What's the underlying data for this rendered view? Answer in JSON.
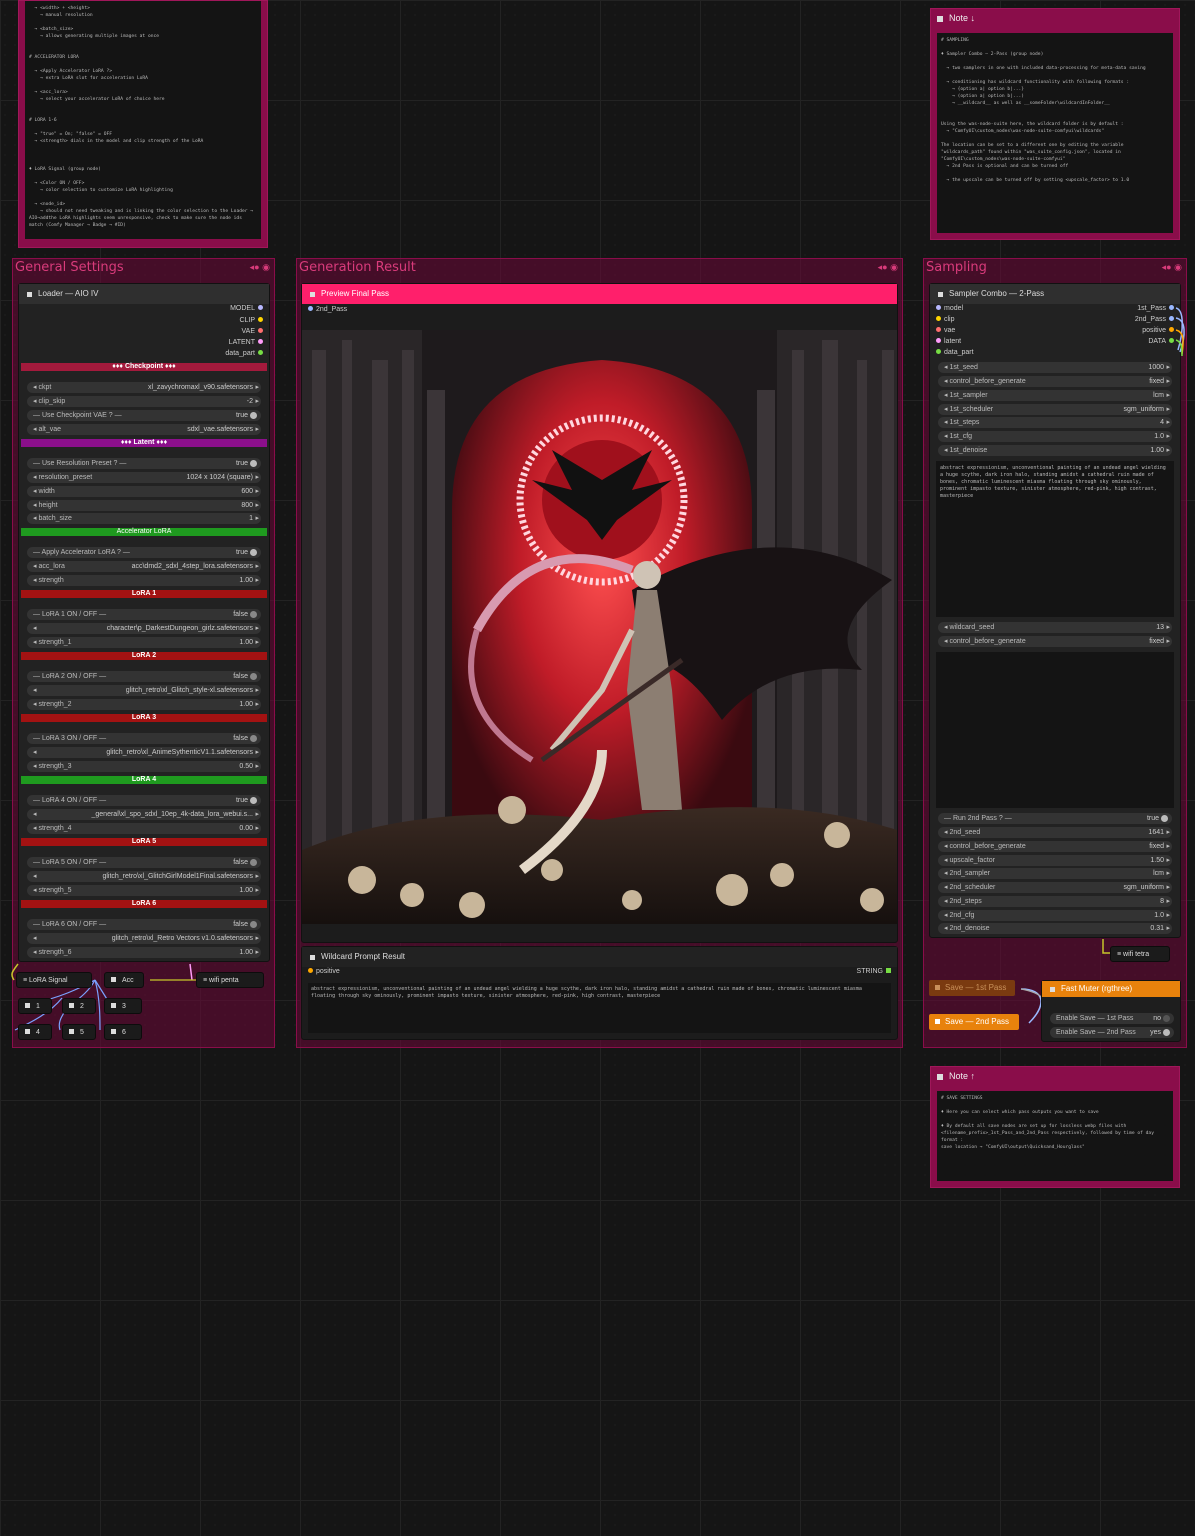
{
  "notes": {
    "top_left": {
      "text": "  → <width> + <height>\n    → manual resolution\n\n  → <batch_size>\n    → allows generating multiple images at once\n\n\n# ACCELERATOR LORA\n\n  → <Apply Accelerator LoRA ?>\n    → extra LoRA slot for acceleration LoRA\n\n  → <acc_lora>\n    → select your accelerator LoRA of choice here\n\n\n# LORA 1-6\n\n  → \"true\" = On; \"false\" = OFF\n  → <strength> dials in the model and clip strength of the LoRA\n\n\n\n♦ LoRA Signal (group node)\n\n  → <Color ON / OFF>\n    → color selection to customize LoRA highlighting\n\n  → <node_id>\n    → should not need tweaking and is linking the color selection to the Loader →\nAIO→addthe LoRA highlights seem unresponsive, check to make sure the node ids\nmatch (Comfy Manager → Badge → #ID)"
    },
    "top_right": {
      "title": "Note ↓",
      "text": "# SAMPLING\n\n♦ Sampler Combo — 2-Pass (group node)\n\n  → two samplers in one with included data-processing for meta-data saving\n\n  → conditioning has wildcard functionality with following formats :\n    → {option a| option b|...}\n    → (option a| option b|...)\n    → __wildcard__ as well as __someFolder\\wildcardInFolder__\n\n\nUsing the was-node-suite here, the wildcard folder is by default :\n  → \"ComfyUI\\custom_nodes\\was-node-suite-comfyui\\wildcards\"\n\nThe location can be set to a different one by editing the variable\n\"wildcards_path\" found within \"was_suite_config.json\", located in\n\"ComfyUI\\custom_nodes\\was-node-suite-comfyui\"\n  → 2nd Pass is optional and can be turned off\n\n  → the upscale can be turned off by setting <upscale_factor> to 1.0"
    },
    "bottom_right": {
      "title": "Note ↑",
      "text": "# SAVE SETTINGS\n\n♦ Here you can select which pass outputs you want to save\n\n♦ By default all save nodes are set up for lossless webp files with\n<filename_prefix>_1st_Pass_and_2nd_Pass respectively, followed by time of day\nformat :\nsave location → \"ComfyUI\\output\\Quicksand_Hourglass\""
    }
  },
  "groups": {
    "general": {
      "title": "General Settings"
    },
    "generation": {
      "title": "Generation Result"
    },
    "sampling": {
      "title": "Sampling"
    }
  },
  "loader": {
    "title": "Loader — AIO IV",
    "outputs": [
      "MODEL",
      "CLIP",
      "VAE",
      "LATENT",
      "data_part"
    ],
    "checkpoint_banner": "♦♦♦ Checkpoint ♦♦♦",
    "ckpt": {
      "label": "ckpt",
      "value": "xl_zavychromaxl_v90.safetensors"
    },
    "clip_skip": {
      "label": "clip_skip",
      "value": "-2"
    },
    "use_vae": {
      "label": "— Use Checkpoint VAE ? —",
      "value": "true"
    },
    "alt_vae": {
      "label": "alt_vae",
      "value": "sdxl_vae.safetensors"
    },
    "latent_banner": "♦♦♦ Latent ♦♦♦",
    "use_res": {
      "label": "— Use Resolution Preset ? —",
      "value": "true"
    },
    "res_preset": {
      "label": "resolution_preset",
      "value": "1024 x 1024  (square)"
    },
    "width": {
      "label": "width",
      "value": "600"
    },
    "height": {
      "label": "height",
      "value": "800"
    },
    "batch": {
      "label": "batch_size",
      "value": "1"
    },
    "acc_banner": "Accelerator LoRA",
    "apply_acc": {
      "label": "— Apply Accelerator LoRA ? —",
      "value": "true"
    },
    "acc_lora": {
      "label": "acc_lora",
      "value": "acc\\dmd2_sdxl_4step_lora.safetensors"
    },
    "acc_strength": {
      "label": "strength",
      "value": "1.00"
    },
    "loras": [
      {
        "banner": "LoRA 1",
        "color": "#a31212",
        "toggle": "— LoRA 1 ON / OFF —",
        "state": "false",
        "file": "character\\p_DarkestDungeon_girlz.safetensors",
        "slabel": "strength_1",
        "strength": "1.00"
      },
      {
        "banner": "LoRA 2",
        "color": "#a31212",
        "toggle": "— LoRA 2 ON / OFF —",
        "state": "false",
        "file": "glitch_retro\\xl_Glitch_style-xl.safetensors",
        "slabel": "strength_2",
        "strength": "1.00"
      },
      {
        "banner": "LoRA 3",
        "color": "#a31212",
        "toggle": "— LoRA 3 ON / OFF —",
        "state": "false",
        "file": "glitch_retro\\xl_AnimeSythenticV1.1.safetensors",
        "slabel": "strength_3",
        "strength": "0.50"
      },
      {
        "banner": "LoRA 4",
        "color": "#1f9a1f",
        "toggle": "— LoRA 4 ON / OFF —",
        "state": "true",
        "file": "_general\\xl_spo_sdxl_10ep_4k-data_lora_webui.s...",
        "slabel": "strength_4",
        "strength": "0.00"
      },
      {
        "banner": "LoRA 5",
        "color": "#a31212",
        "toggle": "— LoRA 5 ON / OFF —",
        "state": "false",
        "file": "glitch_retro\\xl_GlitchGirlModel1Final.safetensors",
        "slabel": "strength_5",
        "strength": "1.00"
      },
      {
        "banner": "LoRA 6",
        "color": "#a31212",
        "toggle": "— LoRA 6 ON / OFF —",
        "state": "false",
        "file": "glitch_retro\\xl_Retro Vectors v1.0.safetensors",
        "slabel": "strength_6",
        "strength": "1.00"
      }
    ]
  },
  "lora_signal": {
    "title": "LoRA Signal",
    "acc": "Acc",
    "wifi": "wifi penta",
    "nums": [
      "1",
      "2",
      "3",
      "4",
      "5",
      "6"
    ]
  },
  "preview": {
    "title": "Preview Final Pass",
    "input": "2nd_Pass"
  },
  "wildcard": {
    "title": "Wildcard Prompt Result",
    "input": "positive",
    "output": "STRING",
    "text": "abstract expressionism, unconventional painting of an undead angel wielding a huge scythe, dark iron halo, standing amidst a cathedral ruin made of bones, chromatic luminescent miasma floating through sky ominously, prominent impasto texture, sinister atmosphere, red-pink, high contrast, masterpiece"
  },
  "sampler": {
    "title": "Sampler Combo — 2-Pass",
    "inputs": [
      "model",
      "clip",
      "vae",
      "latent",
      "data_part"
    ],
    "outputs": [
      "1st_Pass",
      "2nd_Pass",
      "positive",
      "DATA"
    ],
    "w1": [
      {
        "label": "1st_seed",
        "value": "1000"
      },
      {
        "label": "control_before_generate",
        "value": "fixed"
      },
      {
        "label": "1st_sampler",
        "value": "lcm"
      },
      {
        "label": "1st_scheduler",
        "value": "sgm_uniform"
      },
      {
        "label": "1st_steps",
        "value": "4"
      },
      {
        "label": "1st_cfg",
        "value": "1.0"
      },
      {
        "label": "1st_denoise",
        "value": "1.00"
      }
    ],
    "prompt": "abstract expressionism, unconventional painting of an undead angel wielding a huge scythe, dark iron halo, standing amidst a cathedral ruin made of bones, chromatic luminescent miasma floating through sky ominously, prominent impasto texture, sinister atmosphere, red-pink, high contrast, masterpiece",
    "w2": [
      {
        "label": "wildcard_seed",
        "value": "13"
      },
      {
        "label": "control_before_generate",
        "value": "fixed"
      }
    ],
    "run2": {
      "label": "— Run 2nd Pass ? —",
      "value": "true"
    },
    "w3": [
      {
        "label": "2nd_seed",
        "value": "1641"
      },
      {
        "label": "control_before_generate",
        "value": "fixed"
      },
      {
        "label": "upscale_factor",
        "value": "1.50"
      },
      {
        "label": "2nd_sampler",
        "value": "lcm"
      },
      {
        "label": "2nd_scheduler",
        "value": "sgm_uniform"
      },
      {
        "label": "2nd_steps",
        "value": "8"
      },
      {
        "label": "2nd_cfg",
        "value": "1.0"
      },
      {
        "label": "2nd_denoise",
        "value": "0.31"
      }
    ]
  },
  "save": {
    "wifi": "wifi tetra",
    "save1": "Save — 1st Pass",
    "save2": "Save — 2nd Pass",
    "muter": "Fast Muter (rgthree)",
    "en1": {
      "label": "Enable Save — 1st Pass",
      "value": "no"
    },
    "en2": {
      "label": "Enable Save — 2nd Pass",
      "value": "yes"
    }
  },
  "colors": {
    "group": "#8a0d4a",
    "preview_head": "#ff1f6b",
    "orange": "#e8820c",
    "lora_off": "#a31212",
    "lora_on": "#1f9a1f",
    "latent": "#8b0f8b"
  }
}
